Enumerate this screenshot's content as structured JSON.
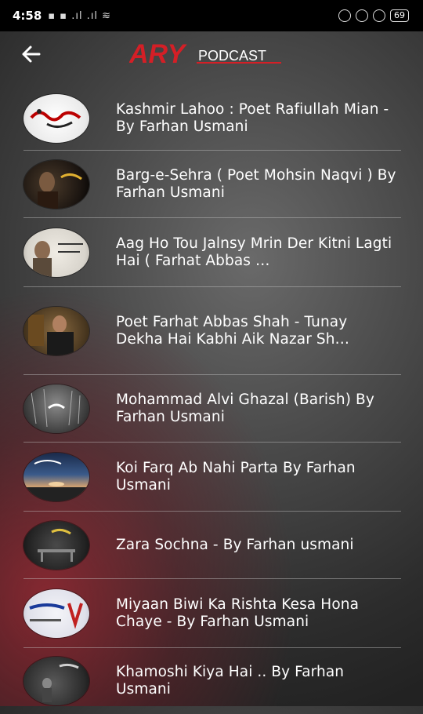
{
  "status_bar": {
    "time": "4:58",
    "icons_text": "▪ ▪ .ıl .ıl ≋",
    "battery": "69"
  },
  "header": {
    "logo_brand": "ARY",
    "logo_sub": "PODCAST",
    "back_icon": "arrow-left-icon"
  },
  "episodes": [
    {
      "title": "Kashmir Lahoo : Poet Rafiullah Mian - By Farhan Usmani"
    },
    {
      "title": "Barg-e-Sehra ( Poet Mohsin Naqvi ) By Farhan Usmani"
    },
    {
      "title": "Aag Ho Tou Jalnsy Mrin Der Kitni Lagti Hai ( Farhat Abbas …"
    },
    {
      "title": "Poet Farhat Abbas Shah - Tunay Dekha Hai Kabhi Aik Nazar Sh…"
    },
    {
      "title": "Mohammad Alvi Ghazal (Barish)  By Farhan Usmani"
    },
    {
      "title": "Koi Farq Ab Nahi Parta By Farhan Usmani"
    },
    {
      "title": "Zara Sochna - By Farhan usmani"
    },
    {
      "title": "Miyaan Biwi Ka Rishta Kesa Hona Chaye - By Farhan Usmani"
    },
    {
      "title": "Khamoshi Kiya Hai .. By Farhan Usmani"
    }
  ],
  "colors": {
    "brand_red": "#d41f26",
    "divider": "#b4b4b4"
  }
}
